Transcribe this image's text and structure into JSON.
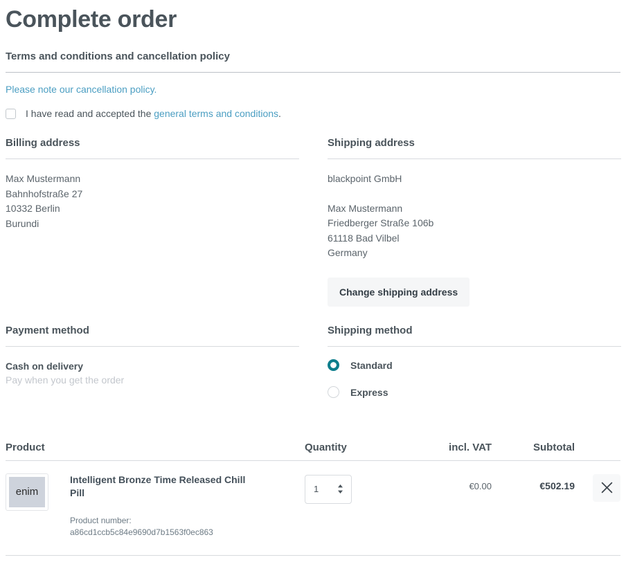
{
  "page": {
    "title": "Complete order"
  },
  "terms": {
    "heading": "Terms and conditions and cancellation policy",
    "cancellation_link": "Please note our cancellation policy.",
    "consent_prefix": "I have read and accepted the ",
    "consent_link": "general terms and conditions",
    "consent_suffix": ".",
    "checkbox_checked": false
  },
  "billing": {
    "heading": "Billing address",
    "lines": [
      "Max Mustermann",
      "Bahnhofstraße 27",
      "10332 Berlin",
      "Burundi"
    ]
  },
  "shipping": {
    "heading": "Shipping address",
    "company": "blackpoint GmbH",
    "lines": [
      "Max Mustermann",
      "Friedberger Straße 106b",
      "61118 Bad Vilbel",
      "Germany"
    ],
    "change_button": "Change shipping address"
  },
  "payment_method": {
    "heading": "Payment method",
    "name": "Cash on delivery",
    "description": "Pay when you get the order"
  },
  "shipping_method": {
    "heading": "Shipping method",
    "options": [
      {
        "label": "Standard",
        "selected": true
      },
      {
        "label": "Express",
        "selected": false
      }
    ]
  },
  "product_table": {
    "columns": {
      "product": "Product",
      "quantity": "Quantity",
      "vat": "incl. VAT",
      "subtotal": "Subtotal"
    },
    "rows": [
      {
        "thumbnail_text": "enim",
        "name": "Intelligent Bronze Time Released Chill Pill",
        "product_number_label": "Product number:",
        "product_number": "a86cd1ccb5c84e9690d7b1563f0ec863",
        "quantity": "1",
        "vat": "€0.00",
        "subtotal": "€502.19",
        "remove_icon": "close-icon"
      }
    ]
  },
  "colors": {
    "text": "#4a545b",
    "link": "#4b9ec2",
    "accent": "#0e7e8c",
    "muted": "#c3c7cd",
    "rule": "#bcc1c7",
    "button_bg": "#f5f6f7"
  }
}
